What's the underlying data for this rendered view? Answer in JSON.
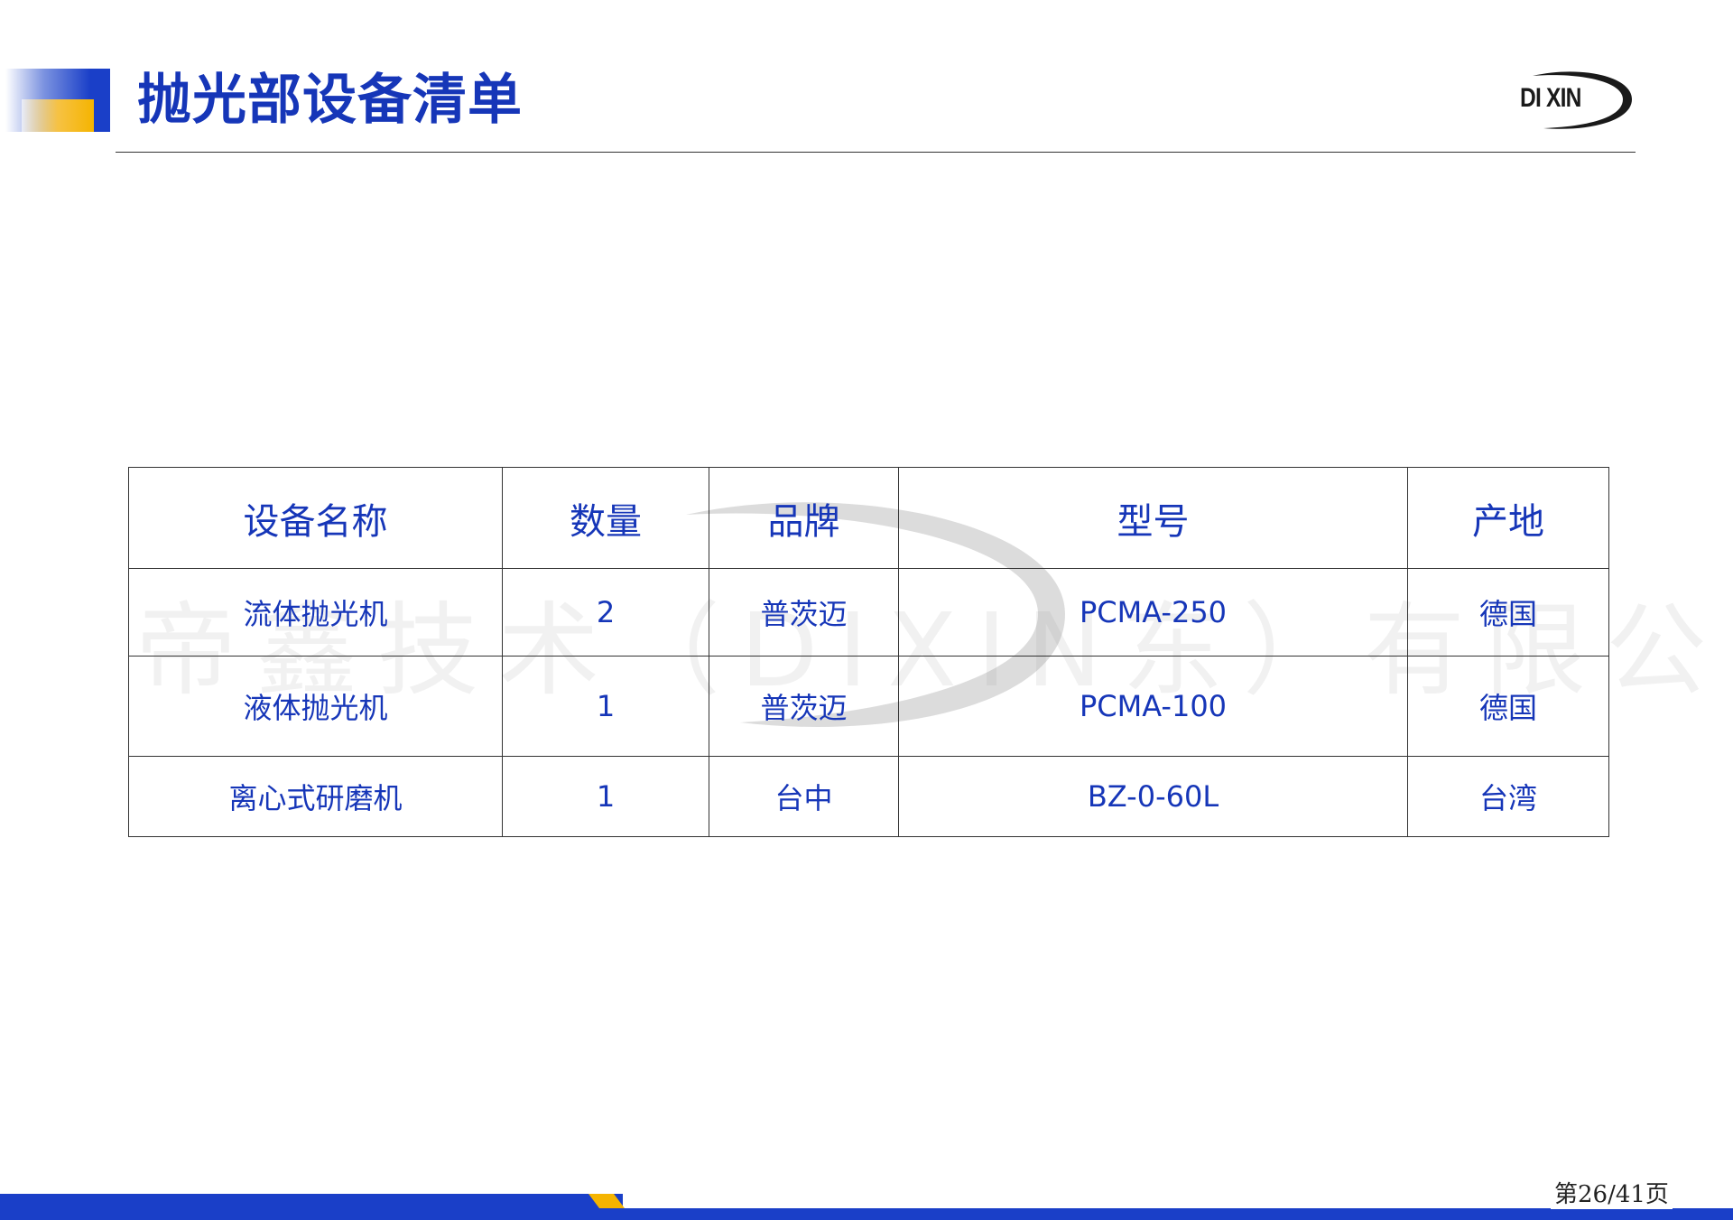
{
  "header": {
    "title": "抛光部设备清单"
  },
  "logo": {
    "text": "DI XIN"
  },
  "watermark": {
    "text": "帝鑫技术（DIXIN东）有限公司"
  },
  "table": {
    "headers": [
      "设备名称",
      "数量",
      "品牌",
      "型号",
      "产地"
    ],
    "rows": [
      [
        "流体抛光机",
        "2",
        "普茨迈",
        "PCMA-250",
        "德国"
      ],
      [
        "液体抛光机",
        "1",
        "普茨迈",
        "PCMA-100",
        "德国"
      ],
      [
        "离心式研磨机",
        "1",
        "台中",
        "BZ-0-60L",
        "台湾"
      ]
    ]
  },
  "footer": {
    "page_number": "第26/41页"
  },
  "colors": {
    "primary": "#1636b8",
    "accent": "#f5b400"
  }
}
